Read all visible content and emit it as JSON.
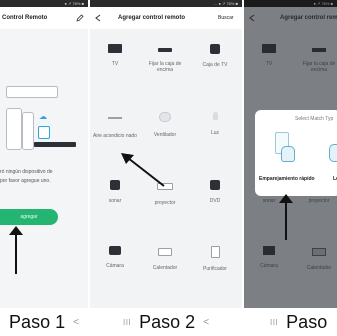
{
  "statusbar": {
    "p1": "● ↗ 76% ■",
    "p2": "… ● ↗ 76% ■",
    "p3": "● ↗ 76% ■"
  },
  "panel1": {
    "header_title": "Control Remoto",
    "edit_icon": "pencil-icon",
    "message": "ró ningún dispositivo de\npor favor agregue uno.",
    "add_button": "agregar",
    "step_label": "Paso 1"
  },
  "panel2": {
    "header_title": "Agregar control remoto",
    "search_label": "Buscar",
    "devices": [
      {
        "label": "TV"
      },
      {
        "label": "Fijar la caja de encima"
      },
      {
        "label": "Caja de TV"
      },
      {
        "label": "Aire acondicio nado"
      },
      {
        "label": "Ventilador"
      },
      {
        "label": "Luz"
      },
      {
        "label": "sonar"
      },
      {
        "label": "proyector"
      },
      {
        "label": "DVD"
      },
      {
        "label": "Cámara"
      },
      {
        "label": "Calentador"
      },
      {
        "label": "Purificador"
      }
    ],
    "step_label": "Paso 2"
  },
  "panel3": {
    "header_title": "Agregar control rem",
    "devices": [
      {
        "label": "TV"
      },
      {
        "label": "Fijar la caja de encima"
      },
      {
        "label": "sonar"
      },
      {
        "label": "proyector"
      },
      {
        "label": "Cámara"
      },
      {
        "label": "Calentador"
      }
    ],
    "dialog": {
      "title": "Select Match Typ",
      "option_quick": "Emparejamiento rápido",
      "option_other": "Le"
    },
    "step_label": "Paso"
  },
  "nav": {
    "back": "<",
    "home": "III"
  },
  "colors": {
    "accent": "#24b573",
    "dark_device": "#2d3036",
    "overlay": "#7c7f84"
  }
}
